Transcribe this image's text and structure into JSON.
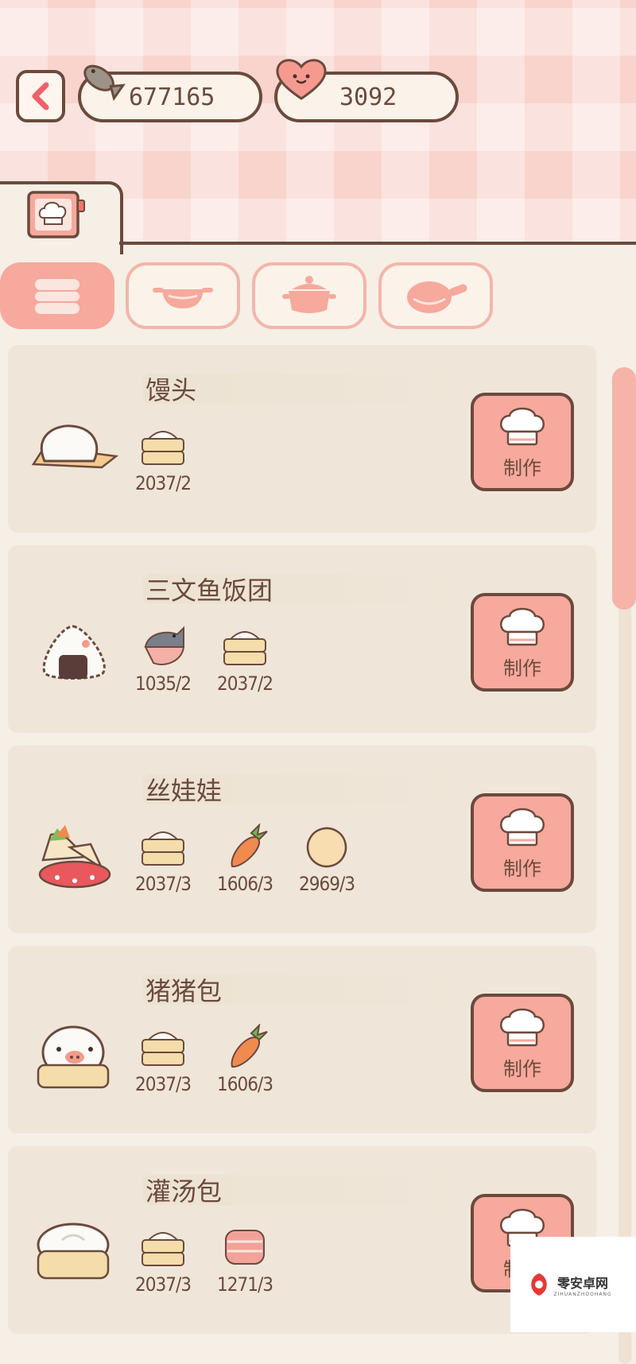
{
  "currencies": {
    "fish": {
      "value": "677165",
      "icon": "fish-coin-icon"
    },
    "hearts": {
      "value": "3092",
      "icon": "heart-icon"
    }
  },
  "colors": {
    "accent": "#f6a99c",
    "outline": "#6b4a3d",
    "card": "#efe6d9",
    "background": "#f5efe6"
  },
  "main_tab": {
    "icon": "recipe-book-icon"
  },
  "categories": [
    {
      "icon": "steamer-icon",
      "active": true
    },
    {
      "icon": "wok-icon",
      "active": false
    },
    {
      "icon": "pot-icon",
      "active": false
    },
    {
      "icon": "frying-pan-icon",
      "active": false
    }
  ],
  "recipes": [
    {
      "name": "馒头",
      "dish_icon": "mantou-icon",
      "make_label": "制作",
      "ingredients": [
        {
          "icon": "flour-steamer-icon",
          "count": "2037/2"
        }
      ]
    },
    {
      "name": "三文鱼饭团",
      "dish_icon": "onigiri-icon",
      "make_label": "制作",
      "ingredients": [
        {
          "icon": "salmon-icon",
          "count": "1035/2"
        },
        {
          "icon": "flour-steamer-icon",
          "count": "2037/2"
        }
      ]
    },
    {
      "name": "丝娃娃",
      "dish_icon": "spring-roll-icon",
      "make_label": "制作",
      "ingredients": [
        {
          "icon": "flour-steamer-icon",
          "count": "2037/3"
        },
        {
          "icon": "carrot-icon",
          "count": "1606/3"
        },
        {
          "icon": "egg-icon",
          "count": "2969/3"
        }
      ]
    },
    {
      "name": "猪猪包",
      "dish_icon": "pig-bun-icon",
      "make_label": "制作",
      "ingredients": [
        {
          "icon": "flour-steamer-icon",
          "count": "2037/3"
        },
        {
          "icon": "carrot-icon",
          "count": "1606/3"
        }
      ]
    },
    {
      "name": "灌汤包",
      "dish_icon": "soup-dumpling-icon",
      "make_label": "制作",
      "ingredients": [
        {
          "icon": "flour-steamer-icon",
          "count": "2037/3"
        },
        {
          "icon": "meat-icon",
          "count": "1271/3"
        }
      ]
    }
  ],
  "watermark": {
    "title": "零安卓网",
    "subtitle": "ZIHUANZHOOHANG"
  }
}
